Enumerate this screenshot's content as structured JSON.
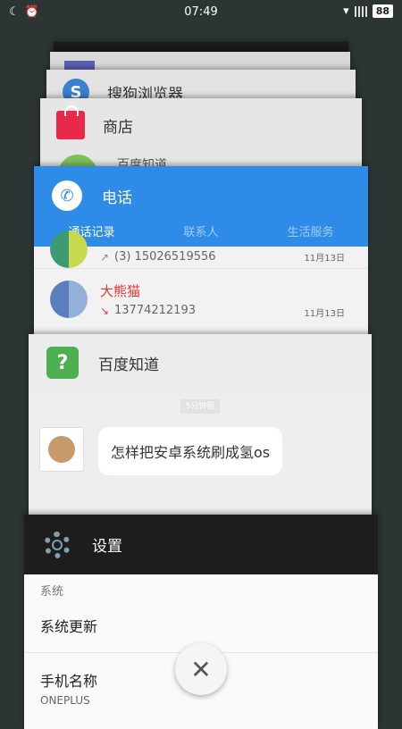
{
  "status_bar": {
    "time": "07:49",
    "battery": "88",
    "left_icons": [
      "moon-icon",
      "alarm-icon"
    ],
    "right_icons": [
      "wifi-icon",
      "signal-icon",
      "battery-icon"
    ]
  },
  "cards": {
    "sogou": {
      "title": "搜狗浏览器"
    },
    "shop": {
      "title": "商店",
      "preview_text": "百度知道"
    },
    "phone": {
      "title": "电话",
      "tabs": [
        "通话记录",
        "联系人",
        "生活服务"
      ],
      "calls": [
        {
          "name": "",
          "number": "(3) 15026519556",
          "date": "11月13日"
        },
        {
          "name": "大熊猫",
          "number": "13774212193",
          "date": "11月13日"
        }
      ]
    },
    "baidu": {
      "title": "百度知道",
      "timestamp": "5分钟前",
      "message": "怎样把安卓系统刷成氢os"
    },
    "settings": {
      "title": "设置",
      "section": "系统",
      "items": [
        {
          "label": "系统更新"
        },
        {
          "label": "手机名称",
          "value": "ONEPLUS"
        }
      ]
    }
  },
  "colors": {
    "phone_accent": "#2f8be8",
    "missed_call": "#e53935",
    "shop_icon": "#e8294a",
    "baidu_icon": "#4caf50"
  }
}
